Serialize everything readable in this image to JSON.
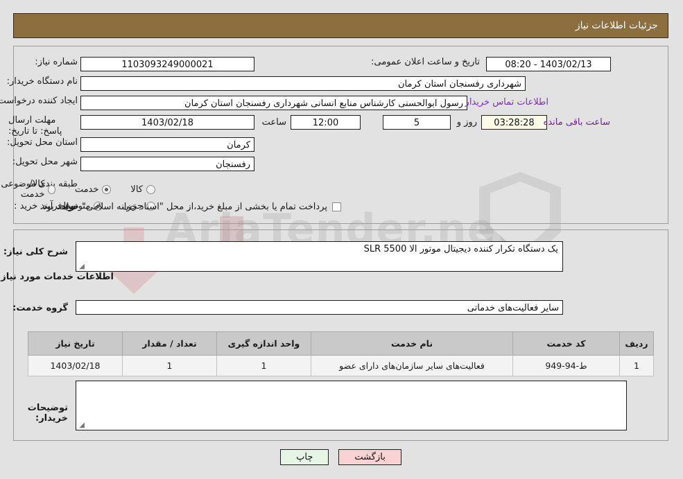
{
  "header": {
    "title": "جزئیات اطلاعات نیاز"
  },
  "watermark": {
    "text": "AriaTender.net"
  },
  "top_form": {
    "need_number_label": "شماره نیاز:",
    "need_number_value": "1103093249000021",
    "buyer_org_label": "نام دستگاه خریدار:",
    "buyer_org_value": "شهرداری رفسنجان استان کرمان",
    "creator_label": "ایجاد کننده درخواست:",
    "creator_value": "رسول ابوالحسنی کارشناس منابع انسانی شهرداری رفسنجان استان کرمان",
    "deadline_label": "مهلت ارسال پاسخ: تا تاریخ:",
    "deadline_date": "1403/02/18",
    "hour_label": "ساعت",
    "hour_value": "12:00",
    "days_value": "5",
    "days_label": "روز و",
    "timer_value": "03:28:28",
    "timer_label": "ساعت باقی مانده",
    "announce_label": "تاریخ و ساعت اعلان عمومی:",
    "announce_value": "1403/02/13 - 08:20",
    "contact_link": "اطلاعات تماس خریدار",
    "province_label": "استان محل تحویل:",
    "province_value": "کرمان",
    "city_label": "شهر محل تحویل:",
    "city_value": "رفسنجان",
    "category_label": "طبقه بندی موضوعی:",
    "category_options": [
      {
        "label": "کالا",
        "selected": false
      },
      {
        "label": "خدمت",
        "selected": true
      },
      {
        "label": "کالا/خدمت",
        "selected": false
      }
    ],
    "process_label": "نوع فرآیند خرید :",
    "process_options": [
      {
        "label": "جزیی",
        "selected": false
      },
      {
        "label": "متوسط",
        "selected": true
      }
    ],
    "treasury_checkbox_label": "پرداخت تمام یا بخشی از مبلغ خرید،از محل \"اسناد خزانه اسلامی\" خواهد بود.",
    "treasury_checked": false
  },
  "bottom": {
    "need_desc_label": "شرح کلی نیاز:",
    "need_desc_value": "یک دستگاه تکرار کننده دیجیتال موتور الا  SLR 5500",
    "services_section_title": "اطلاعات خدمات مورد نیاز",
    "service_group_label": "گروه خدمت:",
    "service_group_value": "سایر فعالیت‌های خدماتی",
    "buyer_notes_label": "توضیحات خریدار:",
    "buyer_notes_value": ""
  },
  "table": {
    "headers": [
      "ردیف",
      "کد خدمت",
      "نام خدمت",
      "واحد اندازه گیری",
      "تعداد / مقدار",
      "تاریخ نیاز"
    ],
    "rows": [
      {
        "row_no": "1",
        "service_code": "ط-94-949",
        "service_name": "فعالیت‌های سایر سازمان‌های دارای عضو",
        "unit": "1",
        "quantity": "1",
        "need_date": "1403/02/18"
      }
    ]
  },
  "buttons": {
    "print": "چاپ",
    "back": "بازگشت"
  },
  "colors": {
    "header_brown": "#8d6e3f",
    "page_bg": "#e2e2e2",
    "link_purple": "#7a30b5",
    "timer_bg": "#fbfbe8",
    "print_btn": "#e6f5e6",
    "back_btn": "#fbd2d2",
    "table_header": "#c9c9c9"
  }
}
